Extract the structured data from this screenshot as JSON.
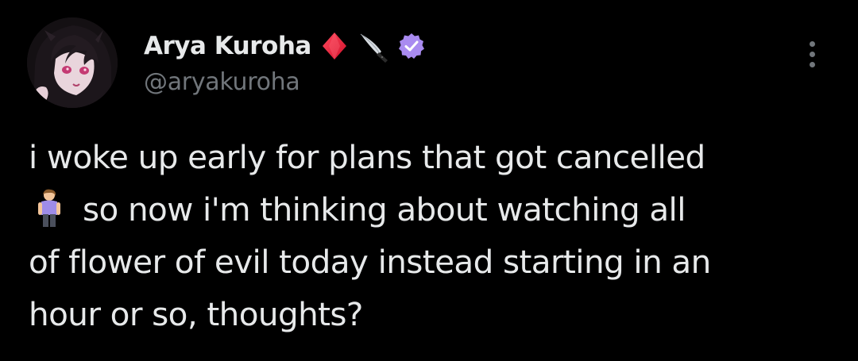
{
  "author": {
    "display_name": "Arya Kuroha",
    "handle": "@aryakuroha",
    "name_emojis": [
      "red-diamond-icon",
      "kitchen-knife-icon"
    ],
    "verified": true,
    "verified_color": "#a98bf0"
  },
  "tweet": {
    "lines": [
      "i woke up early for plans that got cancelled",
      "so now i'm thinking about watching all",
      "of flower of evil today instead starting in an",
      "hour or so, thoughts?"
    ],
    "inline_emoji": "person-standing-icon"
  },
  "colors": {
    "background": "#000000",
    "text_primary": "#e7e9ea",
    "text_secondary": "#71767b"
  }
}
